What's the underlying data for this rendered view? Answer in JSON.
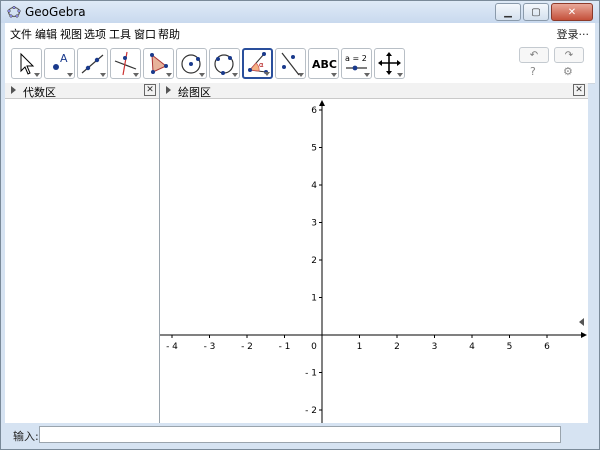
{
  "window": {
    "title": "GeoGebra"
  },
  "menu": {
    "items": [
      "文件",
      "编辑",
      "视图",
      "选项",
      "工具",
      "窗口",
      "帮助"
    ],
    "login": "登录···"
  },
  "toolbar": {
    "tools": [
      {
        "name": "move-tool-icon"
      },
      {
        "name": "new-point-tool-icon",
        "label": "A"
      },
      {
        "name": "line-tool-icon"
      },
      {
        "name": "perpendicular-line-tool-icon"
      },
      {
        "name": "polygon-tool-icon"
      },
      {
        "name": "circle-center-point-tool-icon"
      },
      {
        "name": "circle-three-points-tool-icon"
      },
      {
        "name": "angle-tool-icon",
        "label": "α",
        "selected": true
      },
      {
        "name": "reflect-tool-icon"
      },
      {
        "name": "text-tool-icon",
        "label": "ABC"
      },
      {
        "name": "slider-tool-icon",
        "label": "a = 2"
      },
      {
        "name": "move-graphics-view-tool-icon"
      }
    ],
    "undo": "↶",
    "redo": "↷",
    "help": "?",
    "settings": "⚙"
  },
  "algebra": {
    "title": "代数区"
  },
  "graphics": {
    "title": "绘图区",
    "x_ticks": [
      "- 4",
      "- 3",
      "- 2",
      "- 1",
      "0",
      "1",
      "2",
      "3",
      "4",
      "5",
      "6"
    ],
    "y_ticks": [
      "6",
      "5",
      "4",
      "3",
      "2",
      "1",
      "- 1",
      "- 2"
    ]
  },
  "input": {
    "label": "输入:"
  }
}
